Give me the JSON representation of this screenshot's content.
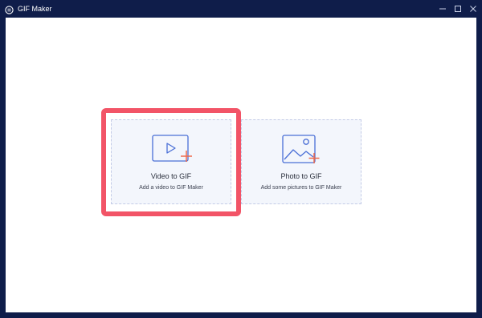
{
  "window": {
    "title": "GIF Maker",
    "app_icon": "gif-maker-logo-icon",
    "controls": [
      "minimize-icon",
      "maximize-icon",
      "close-icon"
    ]
  },
  "cards": [
    {
      "title": "Video to GIF",
      "subtitle": "Add a video to GIF Maker",
      "icon": "video-add-icon",
      "highlighted": true
    },
    {
      "title": "Photo to GIF",
      "subtitle": "Add some pictures to GIF Maker",
      "icon": "photo-add-icon",
      "highlighted": false
    }
  ],
  "colors": {
    "titlebar": "#0f1d4a",
    "card_bg": "#f3f6fc",
    "card_border": "#c3cbe6",
    "icon_blue": "#4a6fd6",
    "plus_orange": "#ef6a4c",
    "highlight": "#f25467"
  }
}
